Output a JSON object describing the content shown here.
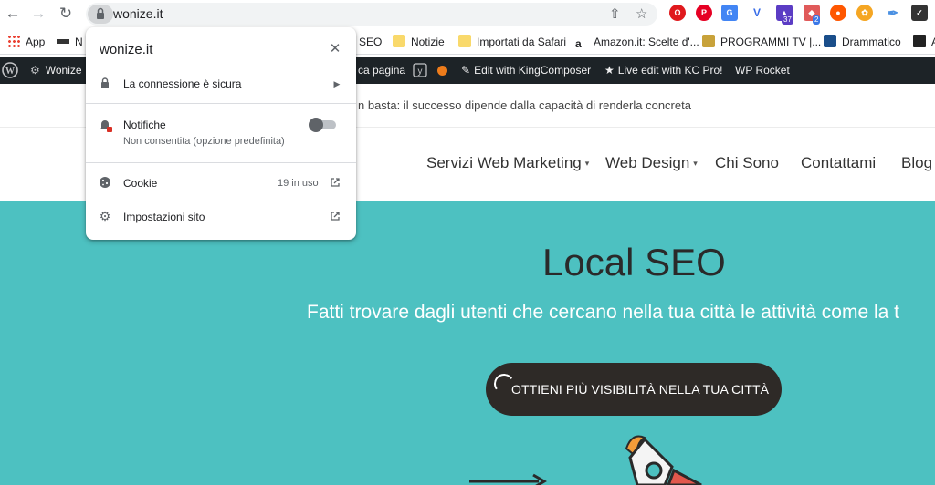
{
  "browser": {
    "url": "wonize.it",
    "extensions": [
      {
        "name": "opera-icon",
        "color": "#e0191d"
      },
      {
        "name": "pinterest-icon",
        "color": "#e60023"
      },
      {
        "name": "translate-icon",
        "color": "#4285f4"
      },
      {
        "name": "v-icon",
        "color": "#3a6ee8"
      },
      {
        "name": "graduation-icon",
        "color": "#5b3cc4",
        "badge": "37"
      },
      {
        "name": "puzzle-icon",
        "color": "#e05a5a",
        "badge": "2"
      },
      {
        "name": "reddit-icon",
        "color": "#ff5700"
      },
      {
        "name": "bug-icon",
        "color": "#f5a623"
      },
      {
        "name": "dropper-icon",
        "color": "#4a90e2"
      },
      {
        "name": "checkmark-icon",
        "color": "#333333"
      }
    ]
  },
  "bookmarks": {
    "items": [
      {
        "label": "App"
      },
      {
        "label": "N"
      },
      {
        "label": "SEO"
      },
      {
        "label": "Notizie"
      },
      {
        "label": "Importati da Safari"
      },
      {
        "label": "Amazon.it: Scelte d'..."
      },
      {
        "label": "PROGRAMMI TV |..."
      },
      {
        "label": "Drammatico"
      },
      {
        "label": "A"
      }
    ]
  },
  "wpbar": {
    "site": "Wonize",
    "page_item": "ca pagina",
    "kingcomposer": "Edit with KingComposer",
    "kc_pro": "Live edit with KC Pro!",
    "wp_rocket": "WP Rocket"
  },
  "site": {
    "tagline": "n basta: il successo dipende dalla capacità di renderla concreta",
    "nav": [
      {
        "label": "Servizi Web Marketing",
        "caret": true
      },
      {
        "label": "Web Design",
        "caret": true
      },
      {
        "label": "Chi Sono",
        "caret": false
      },
      {
        "label": "Contattami",
        "caret": false
      },
      {
        "label": "Blog",
        "caret": false
      }
    ],
    "hero": {
      "title": "Local SEO",
      "subtitle": "Fatti trovare dagli utenti che cercano nella tua città le attività come la t",
      "cta": "OTTIENI PIÙ VISIBILITÀ NELLA TUA CITTÀ",
      "bg_color": "#4dc1c1"
    }
  },
  "popup": {
    "title": "wonize.it",
    "connection": "La connessione è sicura",
    "notifications_label": "Notifiche",
    "notifications_status": "Non consentita (opzione predefinita)",
    "notifications_enabled": false,
    "cookies_label": "Cookie",
    "cookies_count": "19 in uso",
    "site_settings": "Impostazioni sito"
  }
}
